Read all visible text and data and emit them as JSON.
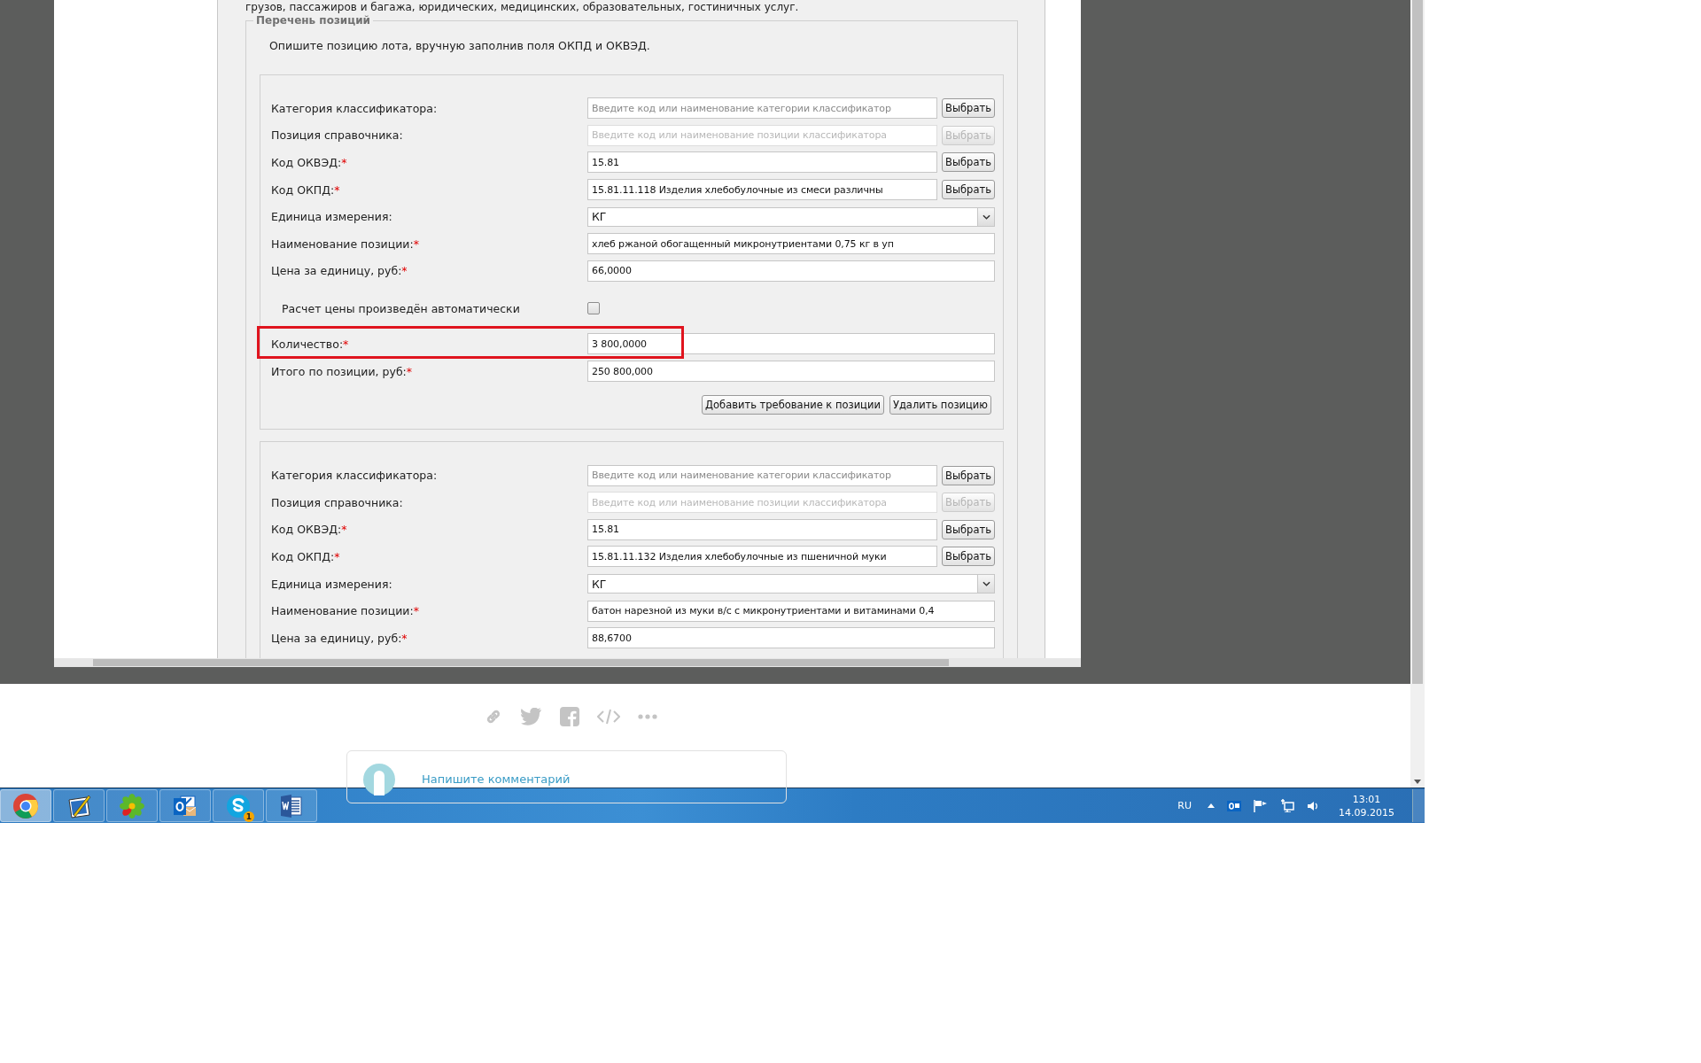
{
  "intro_text": "грузов, пассажиров и багажа, юридических, медицинских, образовательных, гостиничных услуг.",
  "fieldset": {
    "legend": "Перечень позиций",
    "description": "Опишите позицию лота, вручную заполнив поля ОКПД и ОКВЭД.",
    "positions": [
      {
        "rows": [
          {
            "kind": "text",
            "label": "Категория классификатора:",
            "placeholder": "Введите код или наименование категории классификатор",
            "disabled": false,
            "button": "Выбрать",
            "highlighted": false
          },
          {
            "kind": "text",
            "label": "Позиция справочника:",
            "placeholder": "Введите код или наименование позиции классификатора",
            "disabled": true,
            "button": "Выбрать",
            "highlighted": false
          },
          {
            "kind": "text",
            "label": "Код ОКВЭД:",
            "mark": "*",
            "value": "15.81",
            "disabled": false,
            "button": "Выбрать",
            "highlighted": false
          },
          {
            "kind": "text",
            "label": "Код ОКПД:",
            "mark": "*",
            "value": "15.81.11.118 Изделия хлебобулочные из смеси различны",
            "disabled": false,
            "button": "Выбрать",
            "highlighted": false
          },
          {
            "kind": "select",
            "label": "Единица измерения:",
            "value": "КГ",
            "highlighted": false
          },
          {
            "kind": "text",
            "label": "Наименование позиции:",
            "mark": "*",
            "value": "хлеб ржаной обогащенный микронутриентами 0,75 кг в уп",
            "disabled": false,
            "highlighted": false
          },
          {
            "kind": "text",
            "label": "Цена за единицу, руб:",
            "mark": "*",
            "value": "66,0000",
            "disabled": false,
            "highlighted": false
          },
          {
            "kind": "checkbox",
            "label": "Расчет цены произведён автоматически",
            "checked": false,
            "highlighted": false
          },
          {
            "kind": "text",
            "label": "Количество:",
            "mark": "*",
            "value": "3 800,0000",
            "disabled": false,
            "highlighted": true
          },
          {
            "kind": "text",
            "label": "Итого по позиции, руб:",
            "mark": "*",
            "value": "250 800,000",
            "disabled": false,
            "highlighted": false
          }
        ],
        "buttons": [
          "Добавить требование к позиции",
          "Удалить позицию"
        ]
      },
      {
        "rows": [
          {
            "kind": "text",
            "label": "Категория классификатора:",
            "placeholder": "Введите код или наименование категории классификатор",
            "disabled": false,
            "button": "Выбрать",
            "highlighted": false
          },
          {
            "kind": "text",
            "label": "Позиция справочника:",
            "placeholder": "Введите код или наименование позиции классификатора",
            "disabled": true,
            "button": "Выбрать",
            "highlighted": false
          },
          {
            "kind": "text",
            "label": "Код ОКВЭД:",
            "mark": "*",
            "value": "15.81",
            "disabled": false,
            "button": "Выбрать",
            "highlighted": false
          },
          {
            "kind": "text",
            "label": "Код ОКПД:",
            "mark": "*",
            "value": "15.81.11.132 Изделия хлебобулочные из пшеничной муки",
            "disabled": false,
            "button": "Выбрать",
            "highlighted": false
          },
          {
            "kind": "select",
            "label": "Единица измерения:",
            "value": "КГ",
            "highlighted": false
          },
          {
            "kind": "text",
            "label": "Наименование позиции:",
            "mark": "*",
            "value": "батон нарезной из муки в/с с микронутриентами и витаминами 0,4",
            "disabled": false,
            "highlighted": false
          },
          {
            "kind": "text",
            "label": "Цена за единицу, руб:",
            "mark": "*",
            "value": "88,6700",
            "disabled": false,
            "highlighted": false
          }
        ]
      }
    ]
  },
  "comment": {
    "placeholder": "Напишите комментарий"
  },
  "taskbar": {
    "apps": [
      {
        "kind": "chrome",
        "selected": true
      },
      {
        "kind": "paint",
        "selected": false
      },
      {
        "kind": "flower",
        "selected": false
      },
      {
        "kind": "mail",
        "selected": false
      },
      {
        "kind": "skype",
        "selected": false,
        "badge": "1"
      },
      {
        "kind": "word",
        "selected": false
      }
    ],
    "language": "RU",
    "time": "13:01",
    "date": "14.09.2015"
  }
}
